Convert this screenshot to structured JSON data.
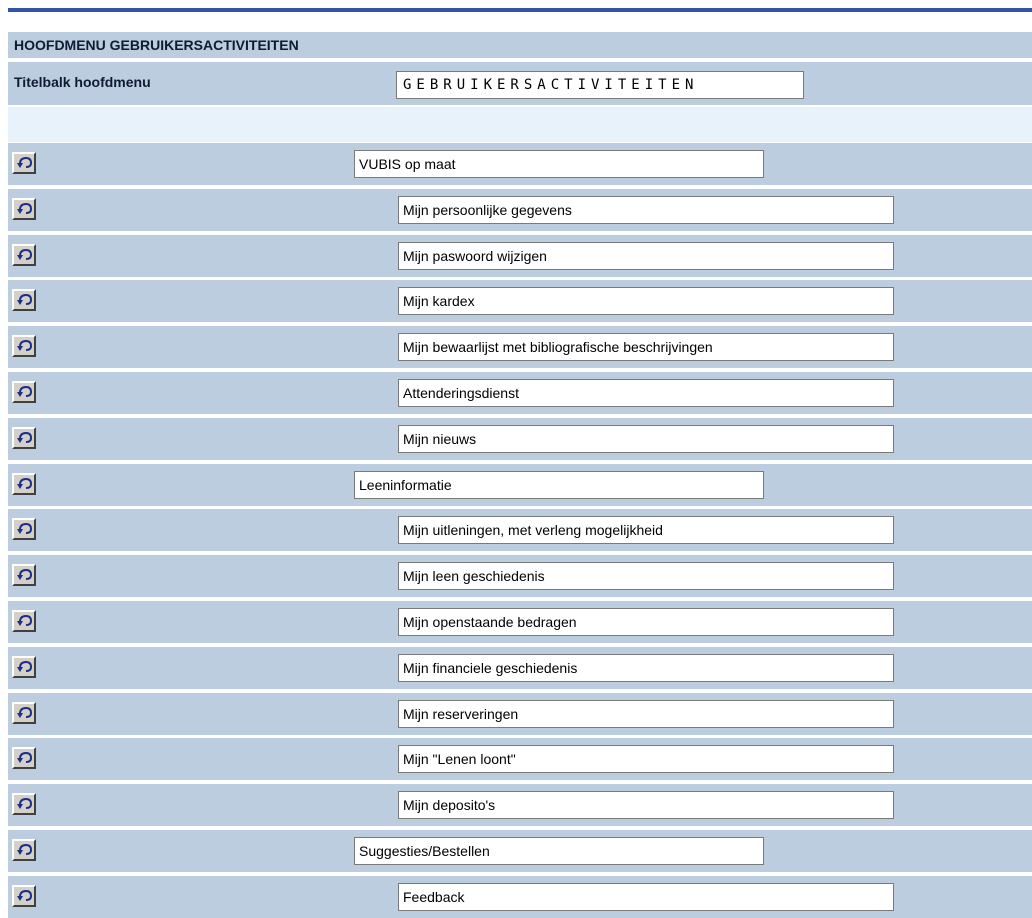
{
  "header": {
    "title": "HOOFDMENU GEBRUIKERSACTIVITEITEN"
  },
  "titlebar": {
    "label": "Titelbalk hoofdmenu",
    "value": "GEBRUIKERSACTIVITEITEN"
  },
  "colors": {
    "row_bg": "#bccddf",
    "spacer_bg": "#e8f2fb",
    "top_rule": "#3353a6"
  },
  "icons": {
    "reset": "undo-arrow-icon"
  },
  "menu": [
    {
      "label": "VUBIS op maat",
      "level": 1
    },
    {
      "label": "Mijn persoonlijke gegevens",
      "level": 2
    },
    {
      "label": "Mijn paswoord wijzigen",
      "level": 2
    },
    {
      "label": "Mijn kardex",
      "level": 2
    },
    {
      "label": "Mijn bewaarlijst met bibliografische beschrijvingen",
      "level": 2
    },
    {
      "label": "Attenderingsdienst",
      "level": 2
    },
    {
      "label": "Mijn nieuws",
      "level": 2
    },
    {
      "label": "Leeninformatie",
      "level": 1
    },
    {
      "label": "Mijn uitleningen, met verleng mogelijkheid",
      "level": 2
    },
    {
      "label": "Mijn leen geschiedenis",
      "level": 2
    },
    {
      "label": "Mijn openstaande bedragen",
      "level": 2
    },
    {
      "label": "Mijn financiele geschiedenis",
      "level": 2
    },
    {
      "label": "Mijn reserveringen",
      "level": 2
    },
    {
      "label": "Mijn \"Lenen loont\"",
      "level": 2
    },
    {
      "label": "Mijn deposito's",
      "level": 2
    },
    {
      "label": "Suggesties/Bestellen",
      "level": 1
    },
    {
      "label": "Feedback",
      "level": 2
    }
  ]
}
